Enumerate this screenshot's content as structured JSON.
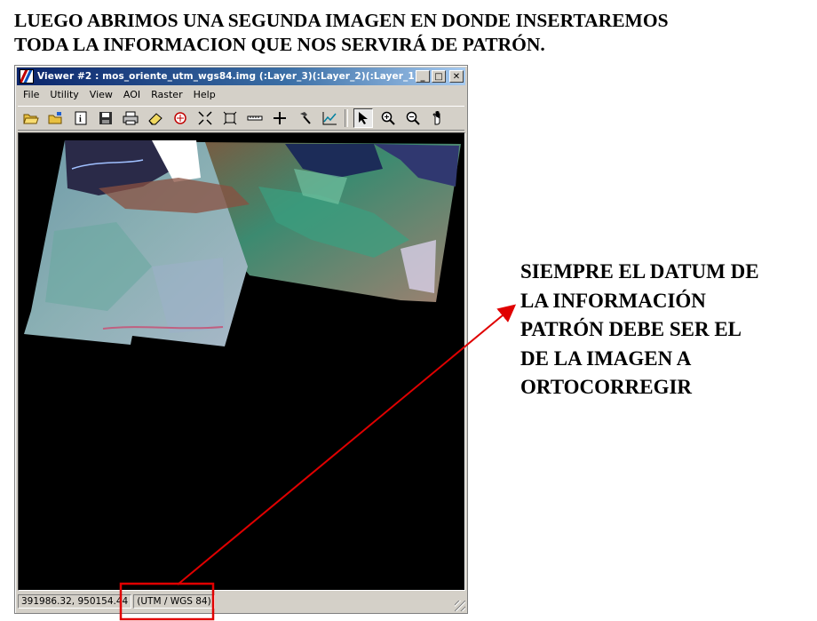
{
  "slide": {
    "heading_lines": [
      "LUEGO ABRIMOS UNA SEGUNDA IMAGEN EN DONDE INSERTAREMOS",
      "TODA LA INFORMACION QUE NOS SERVIRÁ DE PATRÓN."
    ],
    "note_lines": [
      "SIEMPRE EL DATUM DE",
      "LA INFORMACIÓN",
      "PATRÓN DEBE SER EL",
      "DE LA IMAGEN A",
      "ORTOCORREGIR"
    ],
    "annotation_color": "#e00000"
  },
  "window": {
    "title": "Viewer #2 : mos_oriente_utm_wgs84.img (:Layer_3)(:Layer_2)(:Layer_1)",
    "controls": {
      "minimize": "_",
      "maximize": "□",
      "close": "✕"
    },
    "menu": [
      "File",
      "Utility",
      "View",
      "AOI",
      "Raster",
      "Help"
    ],
    "toolbar": [
      {
        "name": "open-icon"
      },
      {
        "name": "open-layer-icon"
      },
      {
        "name": "info-icon"
      },
      {
        "name": "save-icon"
      },
      {
        "name": "print-icon"
      },
      {
        "name": "eraser-icon"
      },
      {
        "name": "layer-info-icon"
      },
      {
        "name": "zoom-in-arrows-icon"
      },
      {
        "name": "zoom-fit-icon"
      },
      {
        "name": "measure-icon"
      },
      {
        "name": "crosshair-icon"
      },
      {
        "name": "hammer-icon"
      },
      {
        "name": "profile-icon"
      },
      {
        "name": "select-arrow-icon"
      },
      {
        "name": "zoom-in-icon"
      },
      {
        "name": "zoom-out-icon"
      },
      {
        "name": "pan-hand-icon"
      }
    ],
    "status": {
      "coordinates": "391986.32, 950154.44",
      "projection": "(UTM / WGS 84)"
    }
  }
}
